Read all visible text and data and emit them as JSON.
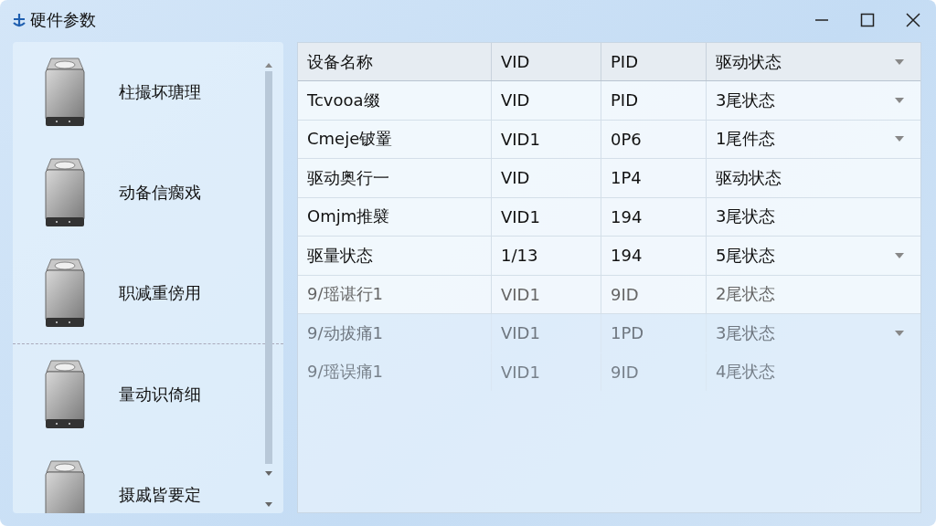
{
  "window": {
    "title": "硬件参数"
  },
  "sidebar": {
    "items": [
      {
        "label": "柱撮坏瑭理",
        "divider_after": false
      },
      {
        "label": "动备信瘸戏",
        "divider_after": false
      },
      {
        "label": "职减重傍用",
        "divider_after": true
      },
      {
        "label": "量动识倚细",
        "divider_after": false
      },
      {
        "label": "摄戚皆要定",
        "divider_after": false
      }
    ]
  },
  "table": {
    "columns": [
      {
        "label": "设备名称",
        "dropdown": false
      },
      {
        "label": "VID",
        "dropdown": false
      },
      {
        "label": "PID",
        "dropdown": false
      },
      {
        "label": "驱动状态",
        "dropdown": true
      }
    ],
    "rows": [
      {
        "kind": "normal",
        "cells": [
          "Tcvooa缀",
          "VID",
          "PID",
          "3尾状态"
        ],
        "dropdown": true
      },
      {
        "kind": "normal",
        "cells": [
          "Cmeje铍罿",
          "VID1",
          "0P6",
          "1尾件态"
        ],
        "dropdown": true
      },
      {
        "kind": "normal",
        "cells": [
          "驱动奥行一",
          "VID",
          "1P4",
          "驱动状态"
        ],
        "dropdown": false
      },
      {
        "kind": "normal",
        "cells": [
          "Omjm推襞",
          "VID1",
          "194",
          "3尾状态"
        ],
        "dropdown": false
      },
      {
        "kind": "normal",
        "cells": [
          "驱量状态",
          "1/13",
          "194",
          "5尾状态"
        ],
        "dropdown": true
      },
      {
        "kind": "dim",
        "cells": [
          "9/瑶谌行1",
          "VID1",
          "9ID",
          "2尾状态"
        ],
        "dropdown": false
      },
      {
        "kind": "ghost",
        "cells": [
          "9/动拔痛1",
          "VID1",
          "1PD",
          "3尾状态"
        ],
        "dropdown": true
      },
      {
        "kind": "faint",
        "cells": [
          "9/瑶误痛1",
          "VID1",
          "9ID",
          "4尾状态"
        ],
        "dropdown": false
      }
    ]
  }
}
